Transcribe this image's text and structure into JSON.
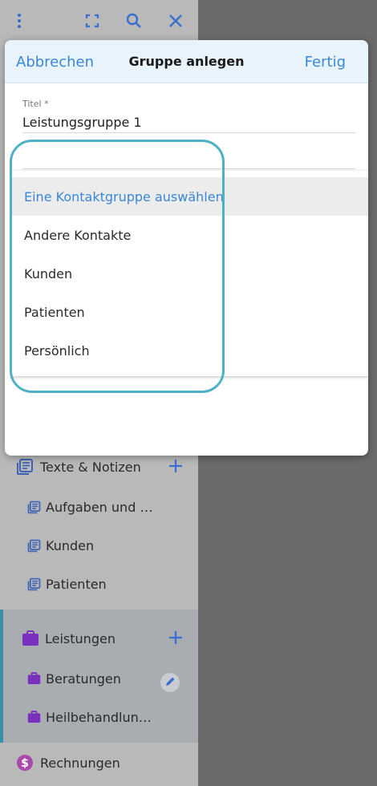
{
  "modal": {
    "cancel_label": "Abbrechen",
    "title": "Gruppe anlegen",
    "done_label": "Fertig",
    "title_field": {
      "label": "Titel *",
      "value": "Leistungsgruppe 1"
    }
  },
  "dropdown": {
    "options": [
      {
        "label": "Eine Kontaktgruppe auswählen",
        "selected": true
      },
      {
        "label": "Andere Kontakte"
      },
      {
        "label": "Kunden"
      },
      {
        "label": "Patienten"
      },
      {
        "label": "Persönlich"
      }
    ]
  },
  "sidebar": {
    "texte_notizen": {
      "label": "Texte & Notizen",
      "children": [
        "Aufgaben und T...",
        "Kunden",
        "Patienten"
      ]
    },
    "leistungen": {
      "label": "Leistungen",
      "children": [
        "Beratungen",
        "Heilbehandlung..."
      ]
    },
    "rechnungen": {
      "label": "Rechnungen"
    }
  },
  "colors": {
    "accent": "#3a87d6",
    "highlight": "#4fb0c6",
    "purple": "#7b2fbf",
    "leistungen_bar": "#3a8fa8"
  }
}
